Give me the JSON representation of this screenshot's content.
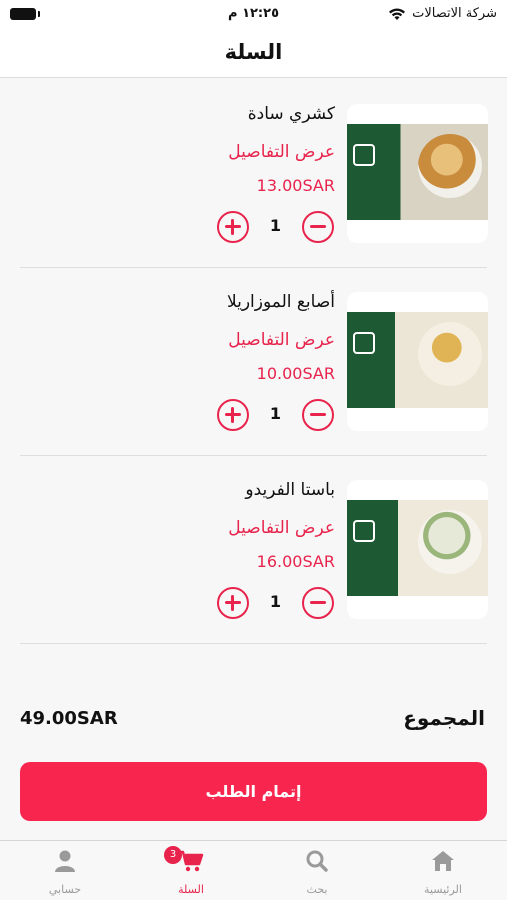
{
  "status_bar": {
    "carrier": "شركة الاتصالات",
    "time": "١٢:٢٥ م"
  },
  "header": {
    "title": "السلة"
  },
  "cart": {
    "items": [
      {
        "name": "كشري سادة",
        "details_label": "عرض التفاصيل",
        "price": "13.00SAR",
        "quantity": "1",
        "image_icon": "koshari-image"
      },
      {
        "name": "أصابع الموزاريلا",
        "details_label": "عرض التفاصيل",
        "price": "10.00SAR",
        "quantity": "1",
        "image_icon": "mozzarella-sticks-image"
      },
      {
        "name": "باستا الفريدو",
        "details_label": "عرض التفاصيل",
        "price": "16.00SAR",
        "quantity": "1",
        "image_icon": "pasta-alfredo-image"
      }
    ]
  },
  "summary": {
    "total_label": "المجموع",
    "total_amount": "49.00SAR"
  },
  "checkout": {
    "label": "إتمام الطلب"
  },
  "tab_bar": {
    "badge_count": "3",
    "tabs": [
      {
        "label": "الرئيسية",
        "icon": "home-icon"
      },
      {
        "label": "بحث",
        "icon": "search-icon"
      },
      {
        "label": "السلة",
        "icon": "cart-icon"
      },
      {
        "label": "حسابي",
        "icon": "user-icon"
      }
    ]
  },
  "colors": {
    "accent": "#e8234c",
    "checkout": "#f8254f",
    "inactive_tab": "#9a9a9a"
  }
}
